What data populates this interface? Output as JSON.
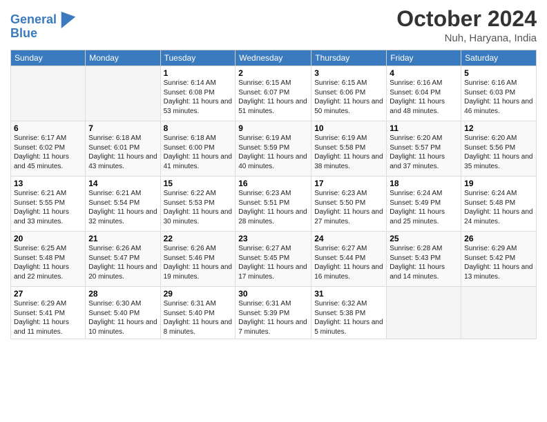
{
  "header": {
    "logo_line1": "General",
    "logo_line2": "Blue",
    "month": "October 2024",
    "location": "Nuh, Haryana, India"
  },
  "days_of_week": [
    "Sunday",
    "Monday",
    "Tuesday",
    "Wednesday",
    "Thursday",
    "Friday",
    "Saturday"
  ],
  "weeks": [
    [
      {
        "day": "",
        "info": ""
      },
      {
        "day": "",
        "info": ""
      },
      {
        "day": "1",
        "info": "Sunrise: 6:14 AM\nSunset: 6:08 PM\nDaylight: 11 hours and 53 minutes."
      },
      {
        "day": "2",
        "info": "Sunrise: 6:15 AM\nSunset: 6:07 PM\nDaylight: 11 hours and 51 minutes."
      },
      {
        "day": "3",
        "info": "Sunrise: 6:15 AM\nSunset: 6:06 PM\nDaylight: 11 hours and 50 minutes."
      },
      {
        "day": "4",
        "info": "Sunrise: 6:16 AM\nSunset: 6:04 PM\nDaylight: 11 hours and 48 minutes."
      },
      {
        "day": "5",
        "info": "Sunrise: 6:16 AM\nSunset: 6:03 PM\nDaylight: 11 hours and 46 minutes."
      }
    ],
    [
      {
        "day": "6",
        "info": "Sunrise: 6:17 AM\nSunset: 6:02 PM\nDaylight: 11 hours and 45 minutes."
      },
      {
        "day": "7",
        "info": "Sunrise: 6:18 AM\nSunset: 6:01 PM\nDaylight: 11 hours and 43 minutes."
      },
      {
        "day": "8",
        "info": "Sunrise: 6:18 AM\nSunset: 6:00 PM\nDaylight: 11 hours and 41 minutes."
      },
      {
        "day": "9",
        "info": "Sunrise: 6:19 AM\nSunset: 5:59 PM\nDaylight: 11 hours and 40 minutes."
      },
      {
        "day": "10",
        "info": "Sunrise: 6:19 AM\nSunset: 5:58 PM\nDaylight: 11 hours and 38 minutes."
      },
      {
        "day": "11",
        "info": "Sunrise: 6:20 AM\nSunset: 5:57 PM\nDaylight: 11 hours and 37 minutes."
      },
      {
        "day": "12",
        "info": "Sunrise: 6:20 AM\nSunset: 5:56 PM\nDaylight: 11 hours and 35 minutes."
      }
    ],
    [
      {
        "day": "13",
        "info": "Sunrise: 6:21 AM\nSunset: 5:55 PM\nDaylight: 11 hours and 33 minutes."
      },
      {
        "day": "14",
        "info": "Sunrise: 6:21 AM\nSunset: 5:54 PM\nDaylight: 11 hours and 32 minutes."
      },
      {
        "day": "15",
        "info": "Sunrise: 6:22 AM\nSunset: 5:53 PM\nDaylight: 11 hours and 30 minutes."
      },
      {
        "day": "16",
        "info": "Sunrise: 6:23 AM\nSunset: 5:51 PM\nDaylight: 11 hours and 28 minutes."
      },
      {
        "day": "17",
        "info": "Sunrise: 6:23 AM\nSunset: 5:50 PM\nDaylight: 11 hours and 27 minutes."
      },
      {
        "day": "18",
        "info": "Sunrise: 6:24 AM\nSunset: 5:49 PM\nDaylight: 11 hours and 25 minutes."
      },
      {
        "day": "19",
        "info": "Sunrise: 6:24 AM\nSunset: 5:48 PM\nDaylight: 11 hours and 24 minutes."
      }
    ],
    [
      {
        "day": "20",
        "info": "Sunrise: 6:25 AM\nSunset: 5:48 PM\nDaylight: 11 hours and 22 minutes."
      },
      {
        "day": "21",
        "info": "Sunrise: 6:26 AM\nSunset: 5:47 PM\nDaylight: 11 hours and 20 minutes."
      },
      {
        "day": "22",
        "info": "Sunrise: 6:26 AM\nSunset: 5:46 PM\nDaylight: 11 hours and 19 minutes."
      },
      {
        "day": "23",
        "info": "Sunrise: 6:27 AM\nSunset: 5:45 PM\nDaylight: 11 hours and 17 minutes."
      },
      {
        "day": "24",
        "info": "Sunrise: 6:27 AM\nSunset: 5:44 PM\nDaylight: 11 hours and 16 minutes."
      },
      {
        "day": "25",
        "info": "Sunrise: 6:28 AM\nSunset: 5:43 PM\nDaylight: 11 hours and 14 minutes."
      },
      {
        "day": "26",
        "info": "Sunrise: 6:29 AM\nSunset: 5:42 PM\nDaylight: 11 hours and 13 minutes."
      }
    ],
    [
      {
        "day": "27",
        "info": "Sunrise: 6:29 AM\nSunset: 5:41 PM\nDaylight: 11 hours and 11 minutes."
      },
      {
        "day": "28",
        "info": "Sunrise: 6:30 AM\nSunset: 5:40 PM\nDaylight: 11 hours and 10 minutes."
      },
      {
        "day": "29",
        "info": "Sunrise: 6:31 AM\nSunset: 5:40 PM\nDaylight: 11 hours and 8 minutes."
      },
      {
        "day": "30",
        "info": "Sunrise: 6:31 AM\nSunset: 5:39 PM\nDaylight: 11 hours and 7 minutes."
      },
      {
        "day": "31",
        "info": "Sunrise: 6:32 AM\nSunset: 5:38 PM\nDaylight: 11 hours and 5 minutes."
      },
      {
        "day": "",
        "info": ""
      },
      {
        "day": "",
        "info": ""
      }
    ]
  ]
}
